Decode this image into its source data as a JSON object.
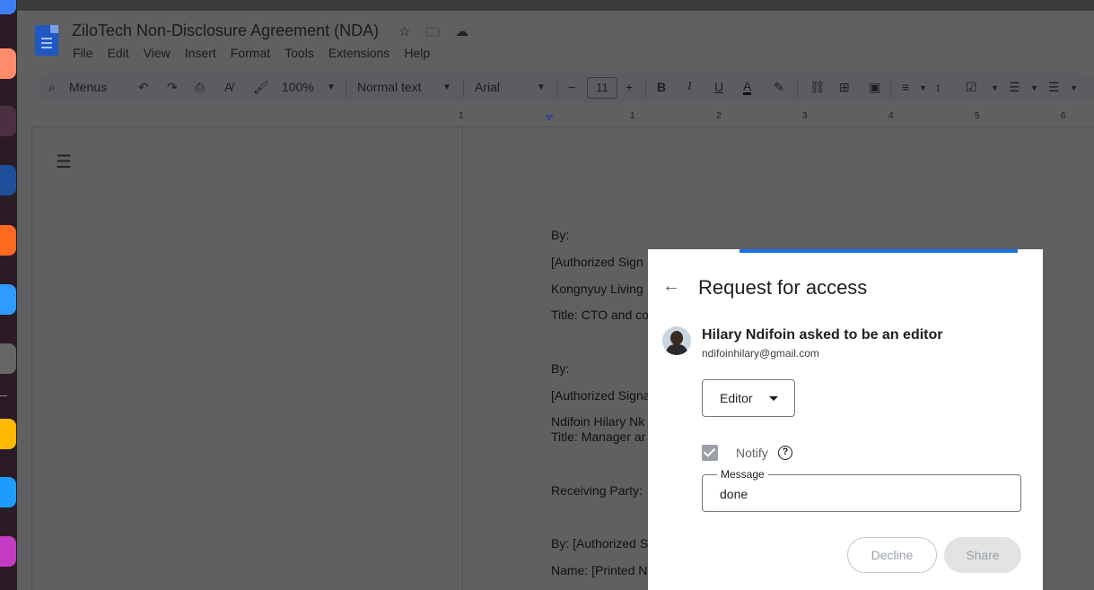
{
  "doc": {
    "title": "ZiloTech Non-Disclosure Agreement (NDA)",
    "menu": [
      "File",
      "Edit",
      "View",
      "Insert",
      "Format",
      "Tools",
      "Extensions",
      "Help"
    ]
  },
  "toolbar": {
    "search_label": "Menus",
    "zoom": "100%",
    "style": "Normal text",
    "font": "Arial",
    "font_size": "11"
  },
  "ruler": {
    "numbers": [
      "1",
      "1",
      "2",
      "3",
      "4",
      "5",
      "6"
    ]
  },
  "document": {
    "lines": [
      "By:",
      "[Authorized Sign",
      "Kongnyuy Living",
      "Title: CTO and co",
      "By:",
      "[Authorized Signa",
      "Ndifoin Hilary Nk",
      "Title: Manager ar",
      "Receiving Party:",
      "By: [Authorized S",
      "Name: [Printed N"
    ]
  },
  "dialog": {
    "title": "Request for access",
    "requester_text": "Hilary Ndifoin asked to be an editor",
    "requester_email": "ndifoinhilary@gmail.com",
    "role": "Editor",
    "notify_label": "Notify",
    "notify_checked": true,
    "message_label": "Message",
    "message_value": "done",
    "decline_label": "Decline",
    "share_label": "Share",
    "accent_color": "#1a73e8"
  },
  "dock": {
    "app_colors": [
      "#3d7ff5",
      "#ff6b4a",
      "#7a4a6a",
      "#3aa0ff",
      "#ff7a2a",
      "#2ea0ff",
      "#777777",
      "#ffb800",
      "#2aa6ff",
      "#c040c0"
    ]
  }
}
